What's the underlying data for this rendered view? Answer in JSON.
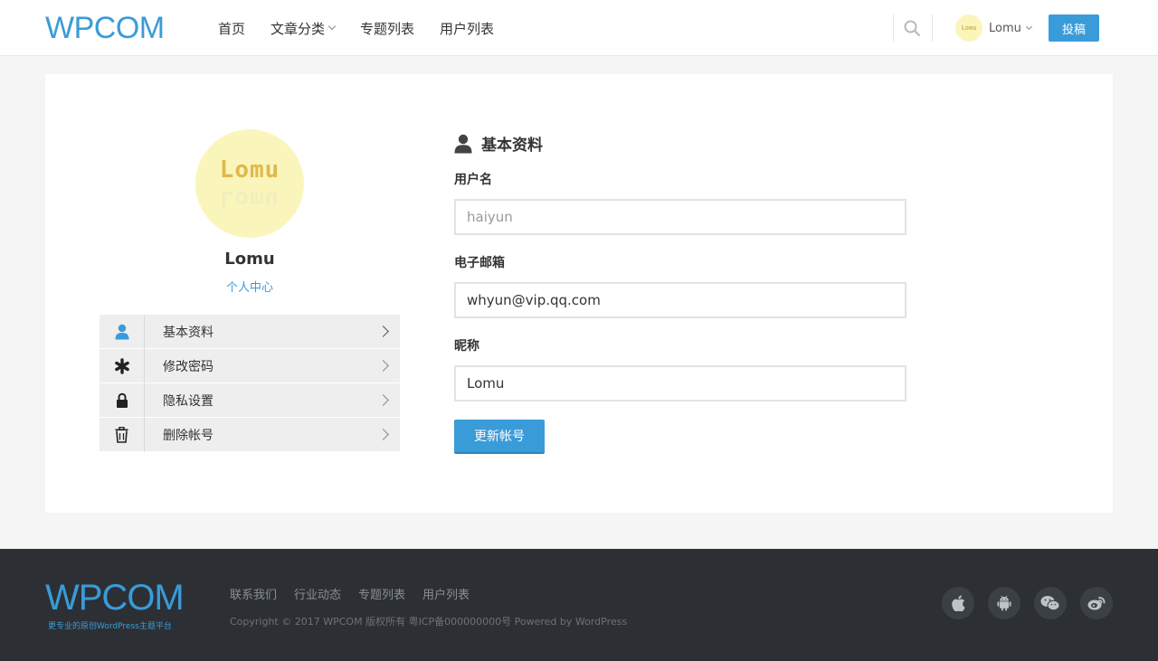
{
  "header": {
    "logo": "WPCOM",
    "nav": [
      {
        "label": "首页",
        "has_dropdown": false
      },
      {
        "label": "文章分类",
        "has_dropdown": true
      },
      {
        "label": "专题列表",
        "has_dropdown": false
      },
      {
        "label": "用户列表",
        "has_dropdown": false
      }
    ],
    "search_icon": "search-icon",
    "user": {
      "avatar_text": "Lomu",
      "name": "Lomu"
    },
    "post_button": "投稿"
  },
  "profile": {
    "avatar_text": "Lomu",
    "name": "Lomu",
    "center_link": "个人中心"
  },
  "menu": [
    {
      "icon": "user-icon",
      "label": "基本资料",
      "active": true
    },
    {
      "icon": "asterisk-icon",
      "label": "修改密码",
      "active": false
    },
    {
      "icon": "lock-icon",
      "label": "隐私设置",
      "active": false
    },
    {
      "icon": "trash-icon",
      "label": "删除帐号",
      "active": false
    }
  ],
  "form": {
    "title": "基本资料",
    "username_label": "用户名",
    "username_value": "haiyun",
    "email_label": "电子邮箱",
    "email_value": "whyun@vip.qq.com",
    "nickname_label": "昵称",
    "nickname_value": "Lomu",
    "submit_label": "更新帐号"
  },
  "footer": {
    "logo": "WPCOM",
    "slogan": "更专业的原创WordPress主题平台",
    "links": [
      "联系我们",
      "行业动态",
      "专题列表",
      "用户列表"
    ],
    "copyright": "Copyright © 2017 WPCOM 版权所有 粤ICP备000000000号 Powered by WordPress",
    "social_icons": [
      "apple-icon",
      "android-icon",
      "wechat-icon",
      "weibo-icon"
    ]
  },
  "colors": {
    "accent": "#3a9bd9",
    "footer_bg": "#2c3035",
    "page_bg": "#f5f5f5",
    "menu_bg": "#eeeeee"
  }
}
